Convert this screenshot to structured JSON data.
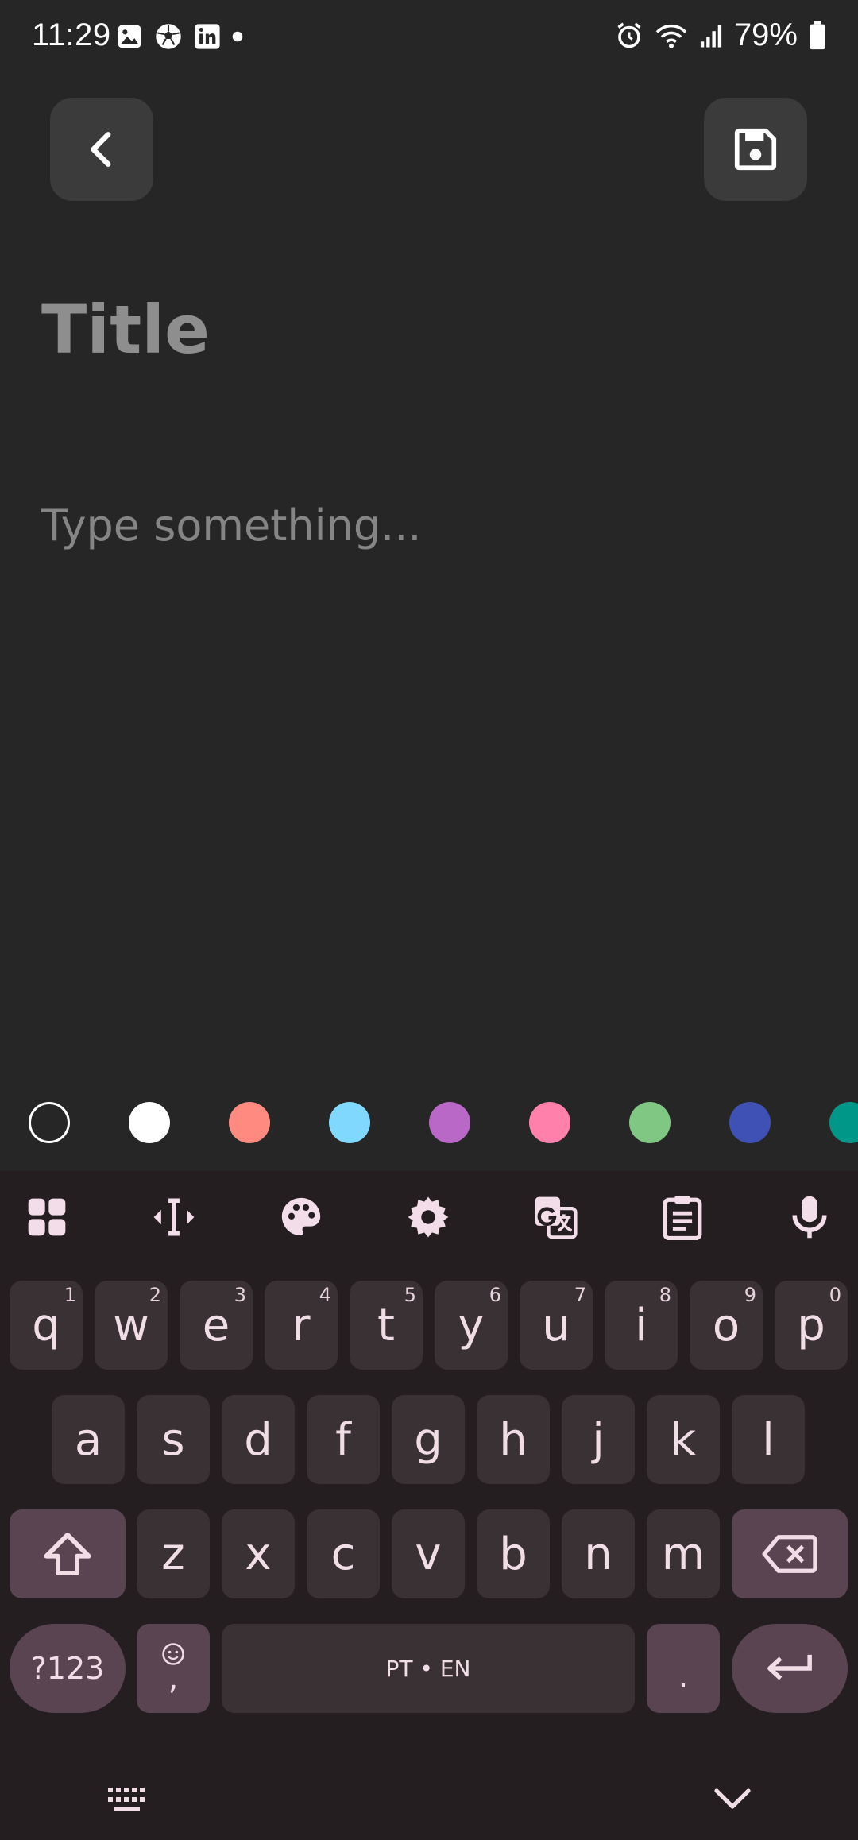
{
  "status_bar": {
    "time": "11:29",
    "battery_text": "79%",
    "left_icons": [
      "image-icon",
      "soccer-ball-icon",
      "linkedin-icon",
      "dot-icon"
    ],
    "right_icons": [
      "alarm-icon",
      "wifi-icon",
      "signal-icon",
      "battery-icon"
    ]
  },
  "toolbar": {
    "back_icon": "chevron-left-icon",
    "save_icon": "floppy-disk-icon"
  },
  "note": {
    "title_placeholder": "Title",
    "title_value": "",
    "body_placeholder": "Type something...",
    "body_value": ""
  },
  "color_swatches": [
    "#262626",
    "#ffffff",
    "#ff8a80",
    "#80d8ff",
    "#ba68c8",
    "#ff80ab",
    "#81c784",
    "#3f51b5",
    "#009688"
  ],
  "keyboard": {
    "toolbar_icons": [
      "apps-grid-icon",
      "text-cursor-icon",
      "palette-icon",
      "gear-icon",
      "translate-icon",
      "clipboard-icon",
      "microphone-icon"
    ],
    "row1": [
      {
        "label": "q",
        "hint": "1"
      },
      {
        "label": "w",
        "hint": "2"
      },
      {
        "label": "e",
        "hint": "3"
      },
      {
        "label": "r",
        "hint": "4"
      },
      {
        "label": "t",
        "hint": "5"
      },
      {
        "label": "y",
        "hint": "6"
      },
      {
        "label": "u",
        "hint": "7"
      },
      {
        "label": "i",
        "hint": "8"
      },
      {
        "label": "o",
        "hint": "9"
      },
      {
        "label": "p",
        "hint": "0"
      }
    ],
    "row2": [
      "a",
      "s",
      "d",
      "f",
      "g",
      "h",
      "j",
      "k",
      "l"
    ],
    "row3": [
      "z",
      "x",
      "c",
      "v",
      "b",
      "n",
      "m"
    ],
    "symbols_label": "?123",
    "emoji_comma_label": ",",
    "space_label": "PT • EN",
    "period_label": ".",
    "bottom_icons": [
      "keyboard-icon",
      "chevron-down-icon"
    ]
  },
  "colors": {
    "background": "#262626",
    "button_bg": "#3b3b3b",
    "keyboard_bg": "#241e21",
    "key_bg": "#3a3135",
    "special_key_bg": "#5a4452"
  }
}
